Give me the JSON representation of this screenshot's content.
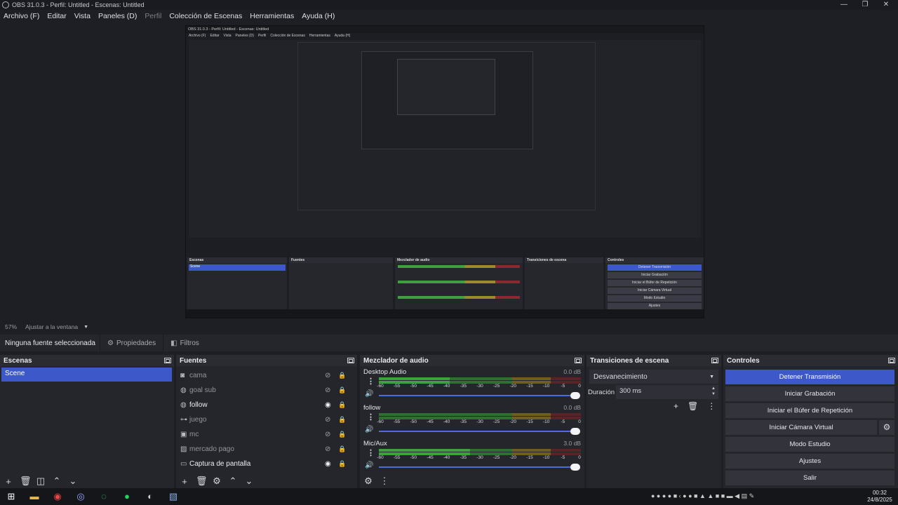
{
  "window": {
    "title": "OBS 31.0.3 - Perfil: Untitled - Escenas: Untitled",
    "minimize": "—",
    "maximize": "❐",
    "close": "✕"
  },
  "menu": [
    {
      "label": "Archivo (F)",
      "disabled": false
    },
    {
      "label": "Editar",
      "disabled": false
    },
    {
      "label": "Vista",
      "disabled": false
    },
    {
      "label": "Paneles (D)",
      "disabled": false
    },
    {
      "label": "Perfil",
      "disabled": true
    },
    {
      "label": "Colección de Escenas",
      "disabled": false
    },
    {
      "label": "Herramientas",
      "disabled": false
    },
    {
      "label": "Ayuda (H)",
      "disabled": false
    }
  ],
  "zoom": {
    "value": "57%",
    "mode": "Ajustar a la ventana"
  },
  "properties_bar": {
    "no_source": "Ninguna fuente seleccionada",
    "properties": "Propiedades",
    "filters": "Filtros"
  },
  "scenes": {
    "title": "Escenas",
    "items": [
      "Scene"
    ]
  },
  "sources": {
    "title": "Fuentes",
    "items": [
      {
        "name": "cama",
        "icon": "camera-icon",
        "visible": false
      },
      {
        "name": "goal sub",
        "icon": "browser-icon",
        "visible": false
      },
      {
        "name": "follow",
        "icon": "browser-icon",
        "visible": true
      },
      {
        "name": "juego",
        "icon": "gamepad-icon",
        "visible": false
      },
      {
        "name": "mc",
        "icon": "capture-icon",
        "visible": false
      },
      {
        "name": "mercado pago",
        "icon": "image-icon",
        "visible": false
      },
      {
        "name": "Captura de pantalla",
        "icon": "monitor-icon",
        "visible": true
      }
    ]
  },
  "mixer": {
    "title": "Mezclador de audio",
    "ticks": [
      "-60",
      "-55",
      "-50",
      "-45",
      "-40",
      "-35",
      "-30",
      "-25",
      "-20",
      "-15",
      "-10",
      "-5",
      "0"
    ],
    "channels": [
      {
        "name": "Desktop Audio",
        "db": "0.0 dB",
        "level": 0.35
      },
      {
        "name": "follow",
        "db": "0.0 dB",
        "level": 0.0
      },
      {
        "name": "Mic/Aux",
        "db": "3.0 dB",
        "level": 0.45
      }
    ]
  },
  "transitions": {
    "title": "Transiciones de escena",
    "selected": "Desvanecimiento",
    "duration_label": "Duración",
    "duration_value": "300 ms"
  },
  "controls": {
    "title": "Controles",
    "buttons": [
      "Detener Transmisión",
      "Iniciar Grabación",
      "Iniciar el Búfer de Repetición",
      "Iniciar Cámara Virtual",
      "Modo Estudio",
      "Ajustes",
      "Salir"
    ]
  },
  "taskbar": {
    "time": "00:32",
    "date": "24/8/2025"
  },
  "nested_preview": {
    "title": "OBS 31.0.3 - Perfil: Untitled - Escenas: Untitled",
    "menu": [
      "Archivo (F)",
      "Editar",
      "Vista",
      "Paneles (D)",
      "Perfil",
      "Colección de Escenas",
      "Herramientas",
      "Ayuda (H)"
    ]
  },
  "colors": {
    "accent": "#3c58c9",
    "panel": "#25262b",
    "meter_green": "#3ea03e",
    "meter_yellow": "#b39a2a",
    "meter_red": "#8a2a30"
  }
}
